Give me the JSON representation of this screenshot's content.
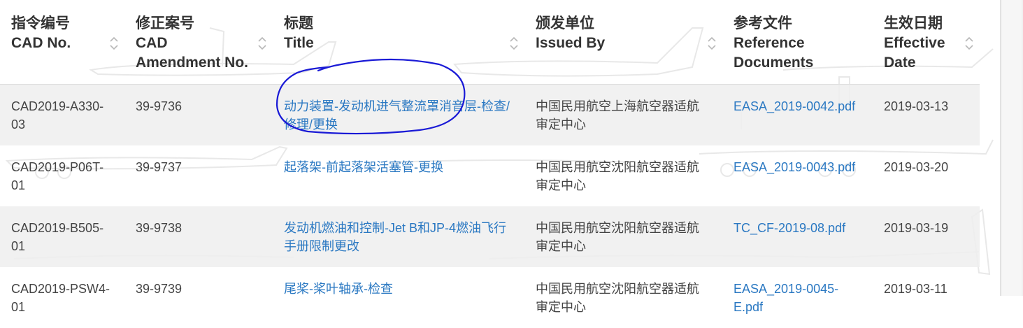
{
  "columns": [
    {
      "zh": "指令编号",
      "en": "CAD No."
    },
    {
      "zh": "修正案号",
      "en": "CAD Amendment No."
    },
    {
      "zh": "标题",
      "en": "Title"
    },
    {
      "zh": "颁发单位",
      "en": "Issued By"
    },
    {
      "zh": "参考文件",
      "en": "Reference Documents"
    },
    {
      "zh": "生效日期",
      "en": "Effective Date"
    }
  ],
  "rows": [
    {
      "cad_no": "CAD2019-A330-03",
      "amendment": "39-9736",
      "title": "动力装置-发动机进气整流罩消音层-检查/修理/更换",
      "issued_by": "中国民用航空上海航空器适航审定中心",
      "reference": "EASA_2019-0042.pdf",
      "date": "2019-03-13"
    },
    {
      "cad_no": "CAD2019-P06T-01",
      "amendment": "39-9737",
      "title": "起落架-前起落架活塞管-更换",
      "issued_by": "中国民用航空沈阳航空器适航审定中心",
      "reference": "EASA_2019-0043.pdf",
      "date": "2019-03-20"
    },
    {
      "cad_no": "CAD2019-B505-01",
      "amendment": "39-9738",
      "title": "发动机燃油和控制-Jet B和JP-4燃油飞行手册限制更改",
      "issued_by": "中国民用航空沈阳航空器适航审定中心",
      "reference": "TC_CF-2019-08.pdf",
      "date": "2019-03-19"
    },
    {
      "cad_no": "CAD2019-PSW4-01",
      "amendment": "39-9739",
      "title": "尾桨-桨叶轴承-检查",
      "issued_by": "中国民用航空沈阳航空器适航审定中心",
      "reference": "EASA_2019-0045-E.pdf",
      "date": "2019-03-11"
    }
  ],
  "colors": {
    "link": "#2a78c2",
    "annotation": "#1a1ad6",
    "row_shade": "#eeeeee"
  },
  "icons": {
    "sort": "sort-updown-icon",
    "watermark": "aircraft-watermark"
  }
}
